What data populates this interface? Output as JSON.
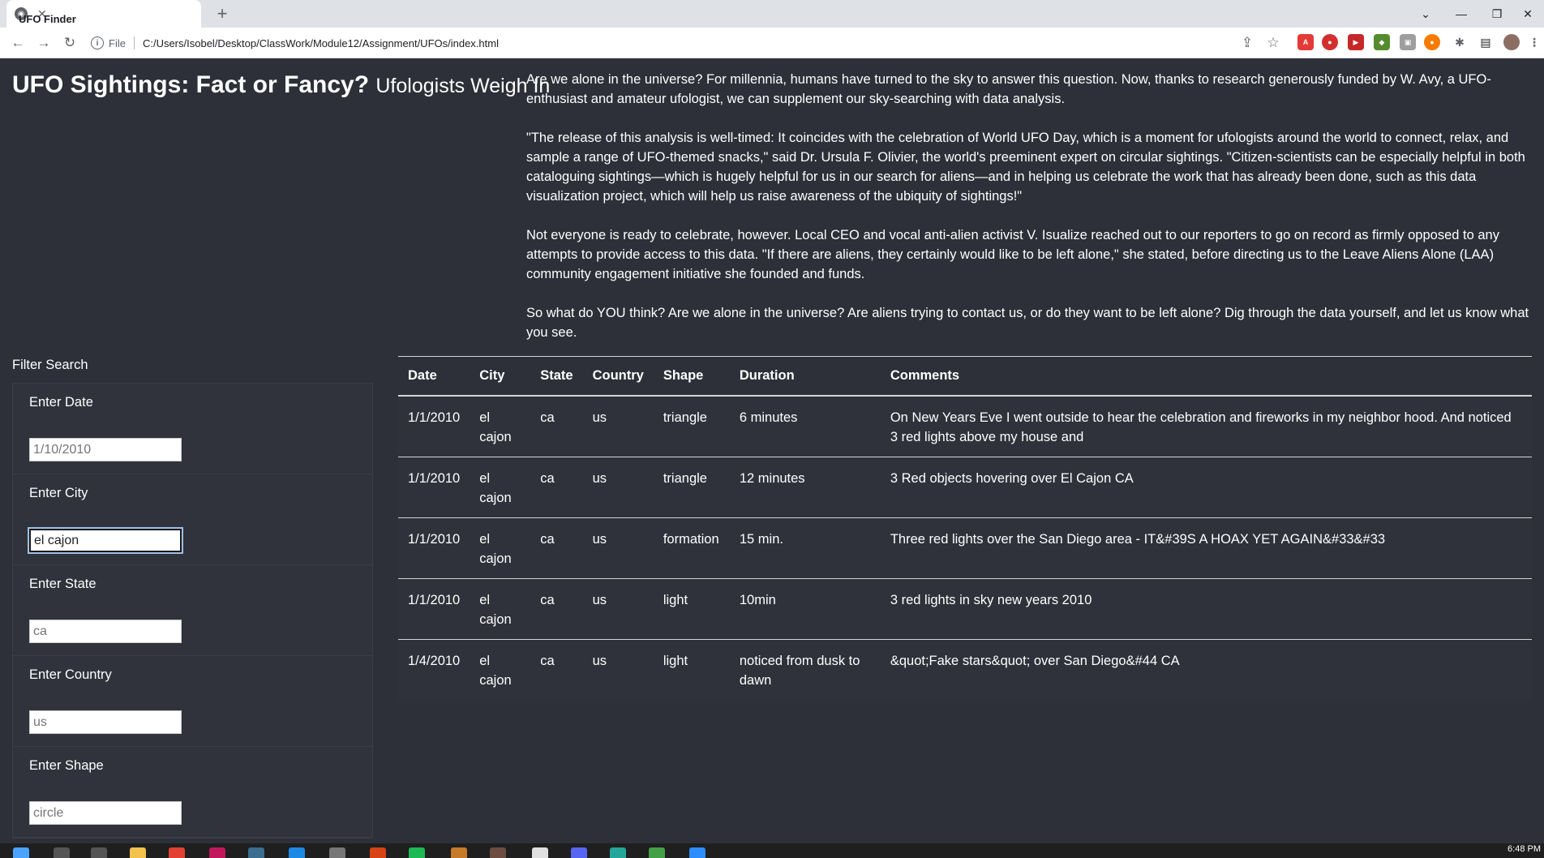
{
  "browser": {
    "tab_title": "UFO Finder",
    "file_label": "File",
    "url": "C:/Users/Isobel/Desktop/ClassWork/Module12/Assignment/UFOs/index.html"
  },
  "header": {
    "title": "UFO Sightings: Fact or Fancy?",
    "subtitle": "Ufologists Weigh In"
  },
  "intro": {
    "p1": "Are we alone in the universe? For millennia, humans have turned to the sky to answer this question. Now, thanks to research generously funded by W. Avy, a UFO-enthusiast and amateur ufologist, we can supplement our sky-searching with data analysis.",
    "p2": "\"The release of this analysis is well-timed: It coincides with the celebration of World UFO Day, which is a moment for ufologists around the world to connect, relax, and sample a range of UFO-themed snacks,\" said Dr. Ursula F. Olivier, the world's preeminent expert on circular sightings. \"Citizen-scientists can be especially helpful in both cataloguing sightings—which is hugely helpful for us in our search for aliens—and in helping us celebrate the work that has already been done, such as this data visualization project, which will help us raise awareness of the ubiquity of sightings!\"",
    "p3": "Not everyone is ready to celebrate, however. Local CEO and vocal anti-alien activist V. Isualize reached out to our reporters to go on record as firmly opposed to any attempts to provide access to this data. \"If there are aliens, they certainly would like to be left alone,\" she stated, before directing us to the Leave Aliens Alone (LAA) community engagement initiative she founded and funds.",
    "p4": "So what do YOU think? Are we alone in the universe? Are aliens trying to contact us, or do they want to be left alone? Dig through the data yourself, and let us know what you see."
  },
  "filter": {
    "title": "Filter Search",
    "fields": [
      {
        "label": "Enter Date",
        "value": "",
        "placeholder": "1/10/2010"
      },
      {
        "label": "Enter City",
        "value": "el cajon",
        "placeholder": ""
      },
      {
        "label": "Enter State",
        "value": "",
        "placeholder": "ca"
      },
      {
        "label": "Enter Country",
        "value": "",
        "placeholder": "us"
      },
      {
        "label": "Enter Shape",
        "value": "",
        "placeholder": "circle"
      }
    ]
  },
  "table": {
    "headers": [
      "Date",
      "City",
      "State",
      "Country",
      "Shape",
      "Duration",
      "Comments"
    ],
    "rows": [
      [
        "1/1/2010",
        "el cajon",
        "ca",
        "us",
        "triangle",
        "6 minutes",
        "On New Years Eve I went outside to hear the celebration and fireworks in my neighbor hood. And noticed 3 red lights above my house and"
      ],
      [
        "1/1/2010",
        "el cajon",
        "ca",
        "us",
        "triangle",
        "12 minutes",
        "3 Red objects hovering over El Cajon CA"
      ],
      [
        "1/1/2010",
        "el cajon",
        "ca",
        "us",
        "formation",
        "15 min.",
        "Three red lights over the San Diego area - IT&#39S A HOAX YET AGAIN&#33&#33"
      ],
      [
        "1/1/2010",
        "el cajon",
        "ca",
        "us",
        "light",
        "10min",
        "3 red lights in sky new years 2010"
      ],
      [
        "1/4/2010",
        "el cajon",
        "ca",
        "us",
        "light",
        "noticed from dusk to dawn",
        "&quot;Fake stars&quot; over San Diego&#44 CA"
      ]
    ]
  },
  "taskbar": {
    "clock": "6:48 PM"
  }
}
